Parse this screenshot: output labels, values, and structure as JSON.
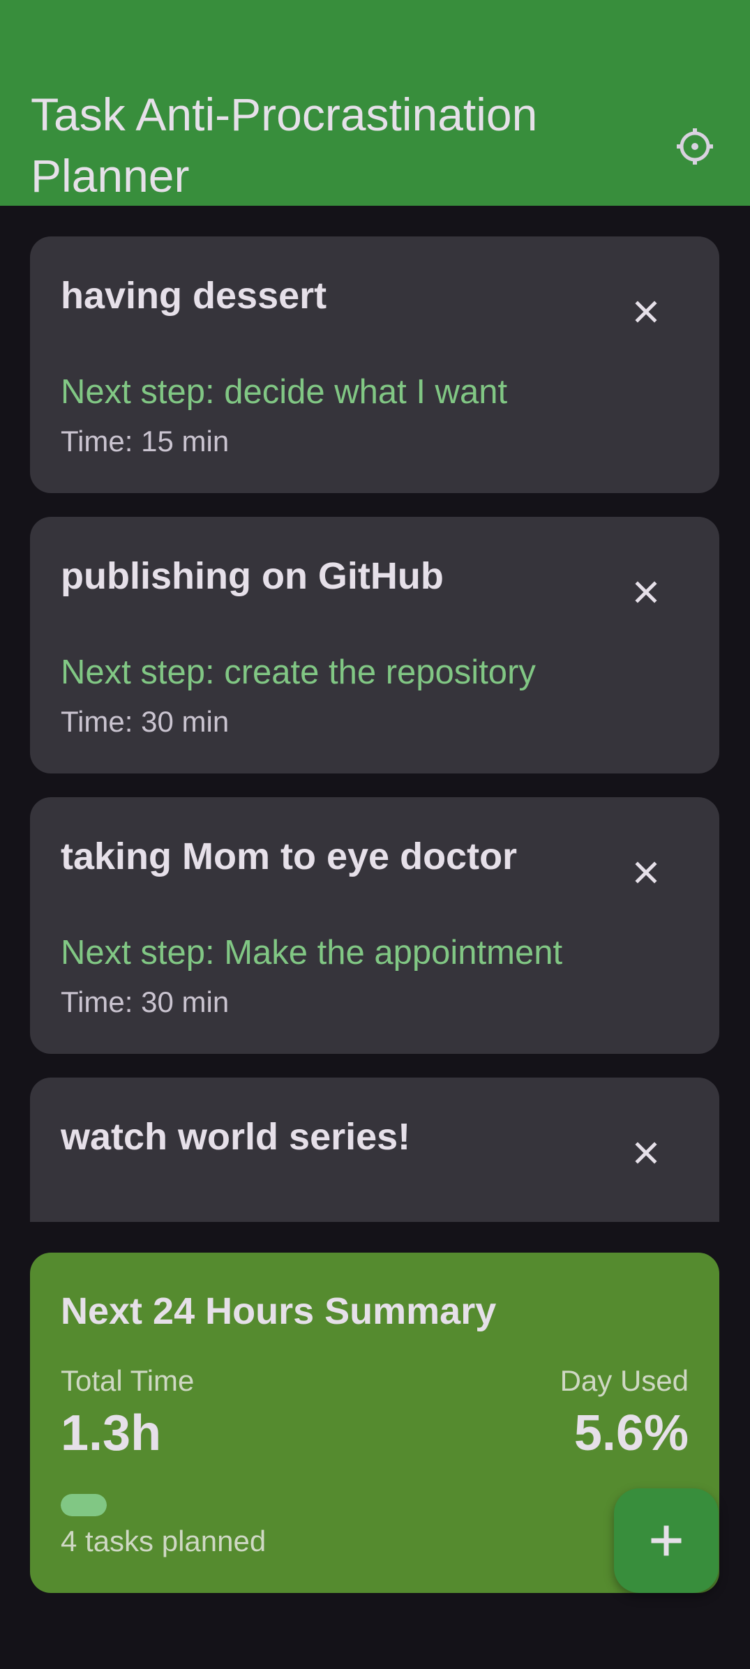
{
  "app_bar": {
    "title": "Task Anti-Procrastination Planner",
    "settings_icon": "settings-icon",
    "background_color": "#388e3c"
  },
  "tasks": [
    {
      "title": "having dessert",
      "next_step": "Next step: decide what I want",
      "time": "Time: 15 min"
    },
    {
      "title": "publishing on GitHub",
      "next_step": "Next step: create the repository",
      "time": "Time: 30 min"
    },
    {
      "title": "taking Mom to eye doctor",
      "next_step": "Next step: Make the appointment",
      "time": "Time: 30 min"
    },
    {
      "title": "watch world series!",
      "next_step": "",
      "time": ""
    }
  ],
  "summary": {
    "title": "Next 24 Hours Summary",
    "total_time_label": "Total Time",
    "total_time_value": "1.3h",
    "day_used_label": "Day Used",
    "day_used_value": "5.6%",
    "day_used_fraction": 0.056,
    "task_count": "4 tasks planned",
    "background_color": "#558b2f"
  },
  "fab": {
    "icon": "plus-icon",
    "label": "+"
  },
  "colors": {
    "background": "#141218",
    "card": "#36343b",
    "accent_text": "#81c784"
  }
}
